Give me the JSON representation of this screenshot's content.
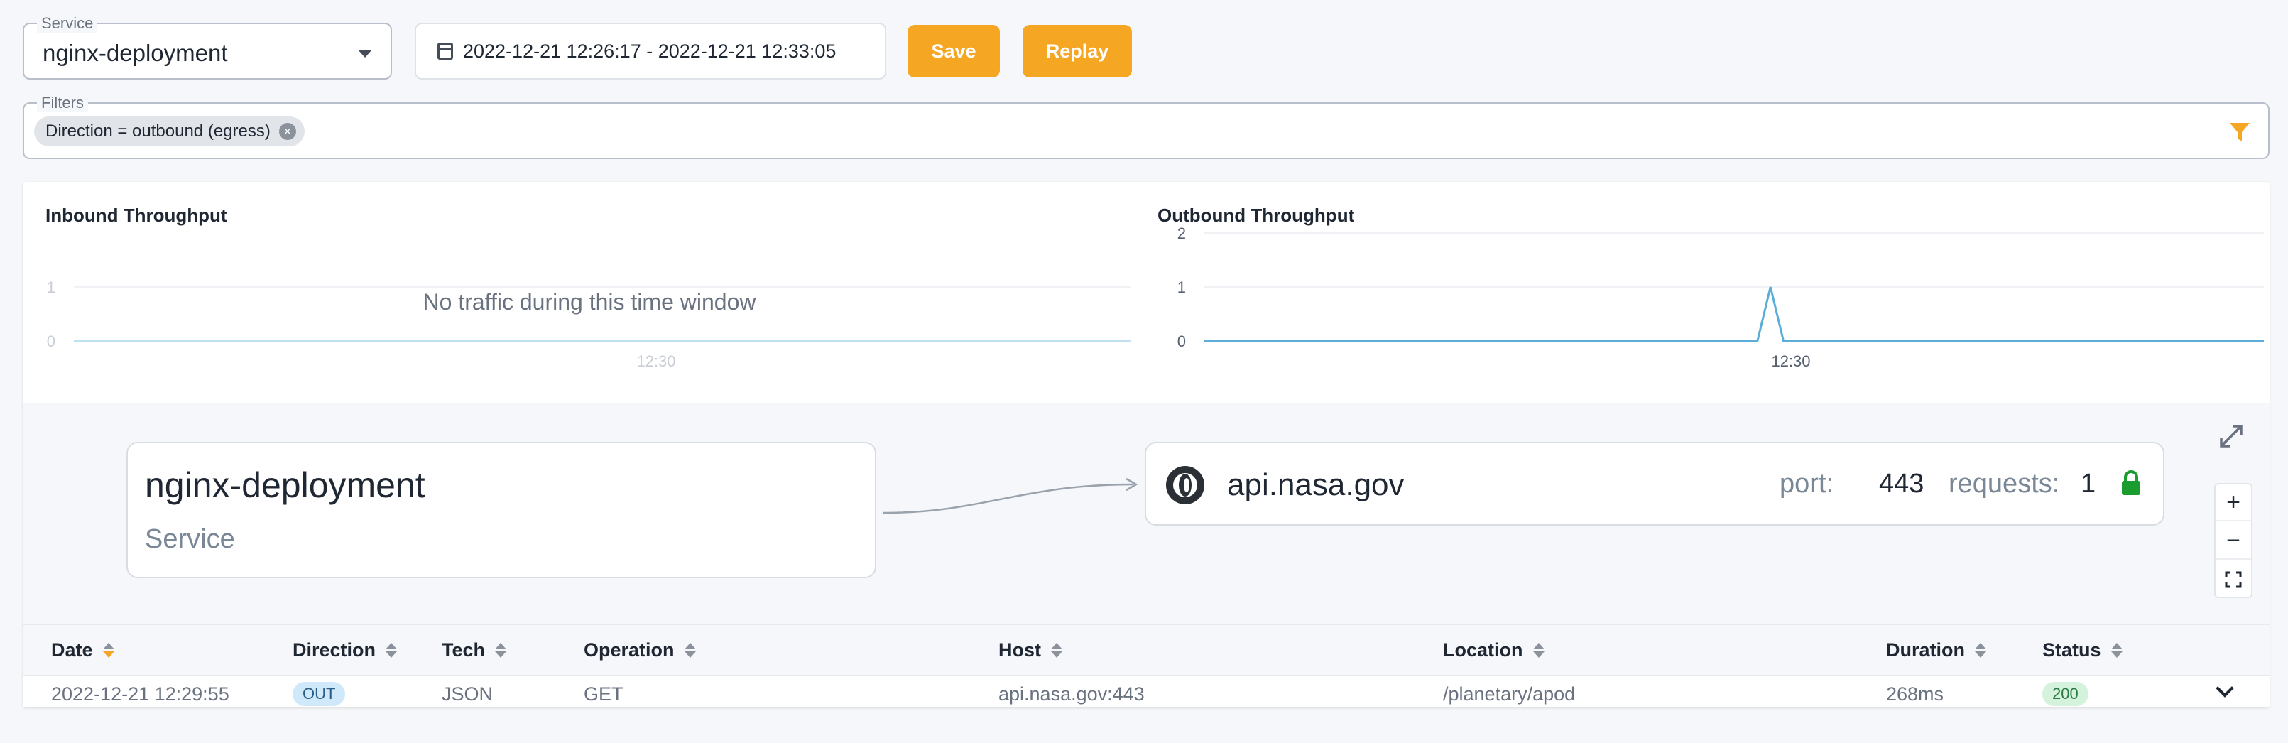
{
  "service": {
    "legend": "Service",
    "value": "nginx-deployment"
  },
  "time_range": {
    "label": "2022-12-21 12:26:17 - 2022-12-21 12:33:05"
  },
  "toolbar": {
    "save_label": "Save",
    "replay_label": "Replay",
    "accent": "#f5a623"
  },
  "filters": {
    "legend": "Filters",
    "chips": [
      "Direction = outbound (egress)"
    ]
  },
  "charts": {
    "inbound": {
      "title": "Inbound Throughput",
      "empty_message": "No traffic during this time window"
    },
    "outbound": {
      "title": "Outbound Throughput"
    }
  },
  "chart_data": [
    {
      "type": "line",
      "title": "Inbound Throughput",
      "x": [],
      "series": [],
      "yticks": [
        "0",
        "1"
      ],
      "xticks": [
        "12:30"
      ],
      "ylim": [
        0,
        1
      ],
      "grid": true
    },
    {
      "type": "line",
      "title": "Outbound Throughput",
      "x": [
        "12:26:17",
        "12:29:50",
        "12:29:55",
        "12:30:00",
        "12:33:05"
      ],
      "series": [
        {
          "values": [
            0,
            0,
            1,
            0,
            0
          ]
        }
      ],
      "yticks": [
        "0",
        "1",
        "2"
      ],
      "xticks": [
        "12:30"
      ],
      "ylim": [
        0,
        2
      ],
      "grid": true,
      "line_color": "#5aaed8"
    }
  ],
  "map": {
    "service_node": {
      "name": "nginx-deployment",
      "type": "Service"
    },
    "host_node": {
      "name": "api.nasa.gov",
      "port_label": "port:",
      "port": "443",
      "requests_label": "requests:",
      "requests": "1",
      "lock_color": "#1a9c2e"
    },
    "zoom": {
      "in": "+",
      "out": "−"
    }
  },
  "table": {
    "columns": [
      "Date",
      "Direction",
      "Tech",
      "Operation",
      "Host",
      "Location",
      "Duration",
      "Status"
    ],
    "rows": [
      {
        "date": "2022-12-21 12:29:55",
        "direction": "OUT",
        "tech": "JSON",
        "operation": "GET",
        "host": "api.nasa.gov:443",
        "location": "/planetary/apod",
        "duration": "268ms",
        "status": "200"
      }
    ]
  }
}
